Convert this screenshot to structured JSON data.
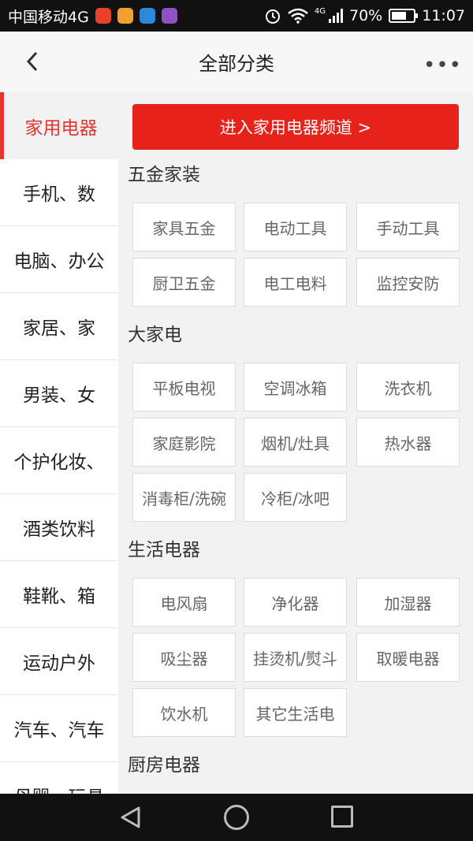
{
  "status_bar": {
    "carrier": "中国移动4G",
    "network_small": "4G",
    "battery": "70%",
    "battery_level": 0.7,
    "time": "11:07",
    "app_icons": [
      {
        "name": "app-icon-red",
        "color": "#e8412c"
      },
      {
        "name": "app-icon-orange",
        "color": "#f0a12c"
      },
      {
        "name": "app-icon-blue",
        "color": "#2a89d8"
      },
      {
        "name": "app-icon-purple",
        "color": "#8e52c7"
      }
    ]
  },
  "header": {
    "title": "全部分类",
    "more": "•••"
  },
  "sidebar": {
    "items": [
      {
        "label": "家用电器",
        "active": true
      },
      {
        "label": "手机、数"
      },
      {
        "label": "电脑、办公"
      },
      {
        "label": "家居、家"
      },
      {
        "label": "男装、女"
      },
      {
        "label": "个护化妆、"
      },
      {
        "label": "酒类饮料"
      },
      {
        "label": "鞋靴、箱"
      },
      {
        "label": "运动户外"
      },
      {
        "label": "汽车、汽车"
      },
      {
        "label": "母婴、玩具"
      }
    ]
  },
  "banner": {
    "label": "进入家用电器频道 >"
  },
  "sections": [
    {
      "title": "五金家装",
      "items": [
        "家具五金",
        "电动工具",
        "手动工具",
        "厨卫五金",
        "电工电料",
        "监控安防"
      ]
    },
    {
      "title": "大家电",
      "items": [
        "平板电视",
        "空调冰箱",
        "洗衣机",
        "家庭影院",
        "烟机/灶具",
        "热水器",
        "消毒柜/洗碗",
        "冷柜/冰吧"
      ]
    },
    {
      "title": "生活电器",
      "items": [
        "电风扇",
        "净化器",
        "加湿器",
        "吸尘器",
        "挂烫机/熨斗",
        "取暖电器",
        "饮水机",
        "其它生活电"
      ]
    },
    {
      "title": "厨房电器",
      "items": []
    }
  ],
  "colors": {
    "accent": "#e4352f",
    "banner": "#e7221b"
  }
}
